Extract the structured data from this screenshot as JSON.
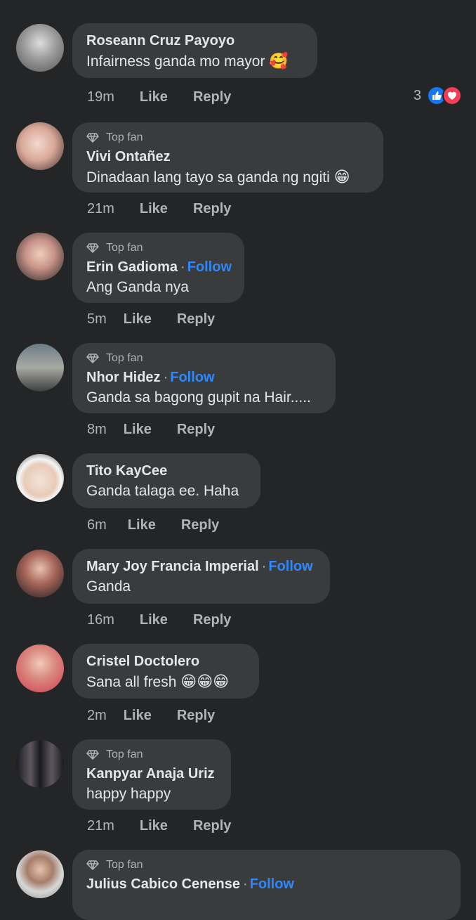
{
  "comments": [
    {
      "name": "Roseann Cruz Payoyo",
      "top_fan": false,
      "follow": false,
      "text": "Infairness ganda mo mayor",
      "emoji": "🥰",
      "time": "19m",
      "reactions_count": "3"
    },
    {
      "name": "Vivi Ontañez",
      "top_fan": true,
      "follow": false,
      "text": "Dinadaan lang tayo sa ganda ng ngiti",
      "emoji": "😁",
      "time": "21m"
    },
    {
      "name": "Erin Gadioma",
      "top_fan": true,
      "follow": true,
      "text": "Ang Ganda nya",
      "emoji": "",
      "time": "5m"
    },
    {
      "name": "Nhor Hidez",
      "top_fan": true,
      "follow": true,
      "text": "Ganda sa bagong gupit na Hair.....",
      "emoji": "",
      "time": "8m"
    },
    {
      "name": "Tito KayCee",
      "top_fan": false,
      "follow": false,
      "text": "Ganda talaga ee. Haha",
      "emoji": "",
      "time": "6m"
    },
    {
      "name": "Mary Joy Francia Imperial",
      "top_fan": false,
      "follow": true,
      "text": "Ganda",
      "emoji": "",
      "time": "16m"
    },
    {
      "name": "Cristel Doctolero",
      "top_fan": false,
      "follow": false,
      "text": "Sana all fresh",
      "emoji": "😁😁😁",
      "time": "2m"
    },
    {
      "name": "Kanpyar Anaja Uriz",
      "top_fan": true,
      "follow": false,
      "text": "happy happy",
      "emoji": "",
      "time": "21m"
    },
    {
      "name": "Julius Cabico Cenense",
      "top_fan": true,
      "follow": true,
      "text": "",
      "emoji": "",
      "time": ""
    }
  ],
  "labels": {
    "top_fan": "Top fan",
    "follow": "Follow",
    "like": "Like",
    "reply": "Reply",
    "dot": "·"
  },
  "colors": {
    "background": "#242526",
    "bubble": "#3a3b3c",
    "follow": "#2d88ff",
    "like_reaction": "#1877f2",
    "love_reaction": "#f33e58"
  }
}
